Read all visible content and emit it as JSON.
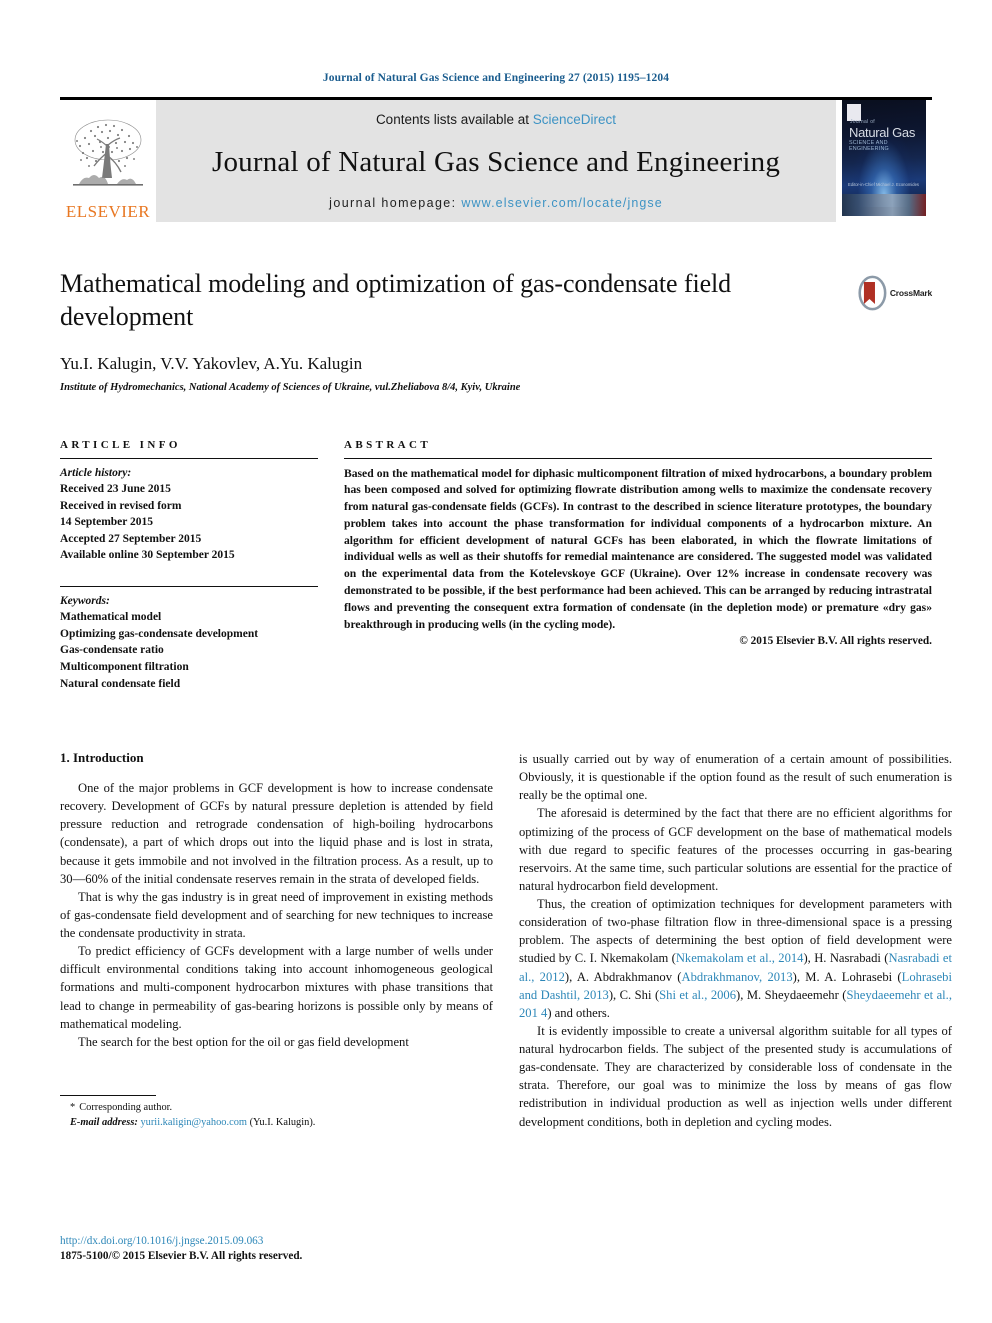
{
  "running_head": "Journal of Natural Gas Science and Engineering 27 (2015) 1195–1204",
  "masthead": {
    "contents_prefix": "Contents lists available at ",
    "sciencedirect": "ScienceDirect",
    "journal_name": "Journal of Natural Gas Science and Engineering",
    "homepage_label": "journal homepage: ",
    "homepage_url": "www.elsevier.com/locate/jngse",
    "publisher": "ELSEVIER",
    "cover": {
      "publisher_small": "ELSEVIER",
      "eyebrow": "Journal of",
      "title": "Natural Gas",
      "subtitle": "SCIENCE AND ENGINEERING",
      "editors": "Editor-in-Chief\nMichael J. Economides"
    },
    "accent_link_color": "#3d93c4",
    "elsevier_orange": "#E87722"
  },
  "article": {
    "title": "Mathematical modeling and optimization of gas-condensate field development",
    "authors": "Yu.I. Kalugin, V.V. Yakovlev, A.Yu. Kalugin",
    "author_marker": "*",
    "affiliation": "Institute of Hydromechanics, National Academy of Sciences of Ukraine, vul.Zheliabova 8/4, Kyiv, Ukraine",
    "crossmark_label": "CrossMark"
  },
  "article_info": {
    "heading": "ARTICLE INFO",
    "history_label": "Article history:",
    "history": [
      "Received 23 June 2015",
      "Received in revised form",
      "14 September 2015",
      "Accepted 27 September 2015",
      "Available online 30 September 2015"
    ],
    "keywords_label": "Keywords:",
    "keywords": [
      "Mathematical model",
      "Optimizing gas-condensate development",
      "Gas-condensate ratio",
      "Multicomponent filtration",
      "Natural condensate field"
    ]
  },
  "abstract": {
    "heading": "ABSTRACT",
    "text": "Based on the mathematical model for diphasic multicomponent filtration of mixed hydrocarbons, a boundary problem has been composed and solved for optimizing flowrate distribution among wells to maximize the condensate recovery from natural gas-condensate fields (GCFs). In contrast to the described in science literature prototypes, the boundary problem takes into account the phase transformation for individual components of a hydrocarbon mixture. An algorithm for efficient development of natural GCFs has been elaborated, in which the flowrate limitations of individual wells as well as their shutoffs for remedial maintenance are considered. The suggested model was validated on the experimental data from the Kotelevskoye GCF (Ukraine). Over 12% increase in condensate recovery was demonstrated to be possible, if the best performance had been achieved. This can be arranged by reducing intrastratal flows and preventing the consequent extra formation of condensate (in the depletion mode) or premature «dry gas» breakthrough in producing wells (in the cycling mode).",
    "copyright": "© 2015 Elsevier B.V. All rights reserved."
  },
  "body": {
    "section_number_title": "1. Introduction",
    "left_paragraphs": [
      "One of the major problems in GCF development is how to increase condensate recovery. Development of GCFs by natural pressure depletion is attended by field pressure reduction and retrograde condensation of high-boiling hydrocarbons (condensate), a part of which drops out into the liquid phase and is lost in strata, because it gets immobile and not involved in the filtration process. As a result, up to 30—60% of the initial condensate reserves remain in the strata of developed fields.",
      "That is why the gas industry is in great need of improvement in existing methods of gas-condensate field development and of searching for new techniques to increase the condensate productivity in strata.",
      "To predict efficiency of GCFs development with a large number of wells under difficult environmental conditions taking into account inhomogeneous geological formations and multi-component hydrocarbon mixtures with phase transitions that lead to change in permeability of gas-bearing horizons is possible only by means of mathematical modeling.",
      "The search for the best option for the oil or gas field development"
    ],
    "right_paragraph_1_cont": "is usually carried out by way of enumeration of a certain amount of possibilities. Obviously, it is questionable if the option found as the result of such enumeration is really be the optimal one.",
    "right_paragraph_2": "The aforesaid is determined by the fact that there are no efficient algorithms for optimizing of the process of GCF development on the base of mathematical models with due regard to specific features of the processes occurring in gas-bearing reservoirs. At the same time, such particular solutions are essential for the practice of natural hydrocarbon field development.",
    "right_paragraph_3_pre": "Thus, the creation of optimization techniques for development parameters with consideration of two-phase filtration flow in three-dimensional space is a pressing problem. The aspects of determining the best option of field development were studied by C. I. Nkemakolam (",
    "citations": [
      "Nkemakolam et al., 2014",
      "Nasrabadi et al., 2012",
      "Abdrakhmanov, 2013",
      "Lohrasebi and Dashtil, 2013",
      "Shi et al., 2006",
      "Sheydaeemehr et al., 201 4"
    ],
    "right_paragraph_3_parts": [
      "), H. Nasrabadi (",
      "), A. Abdrakhmanov (",
      "), M. A. Lohrasebi (",
      "), C. Shi (",
      "), M. Sheydaeemehr (",
      ") and others."
    ],
    "right_paragraph_4": "It is evidently impossible to create a universal algorithm suitable for all types of natural hydrocarbon fields. The subject of the presented study is accumulations of gas-condensate. They are characterized by considerable loss of condensate in the strata. Therefore, our goal was to minimize the loss by means of gas flow redistribution in individual production as well as injection wells under different development conditions, both in depletion and cycling modes."
  },
  "footnote": {
    "corresponding": "Corresponding author.",
    "email_label": "E-mail address:",
    "email": "yurii.kaligin@yahoo.com",
    "email_owner": "(Yu.I. Kalugin)."
  },
  "footer": {
    "doi": "http://dx.doi.org/10.1016/j.jngse.2015.09.063",
    "issn": "1875-5100/© 2015 Elsevier B.V. All rights reserved."
  }
}
